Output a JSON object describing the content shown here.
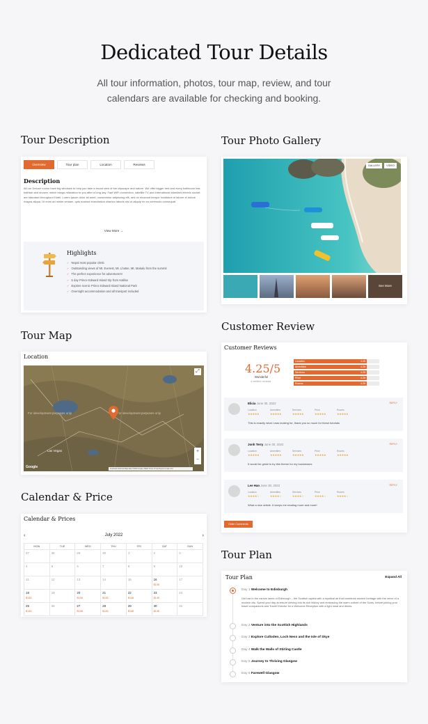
{
  "hero": {
    "title": "Dedicated Tour Details",
    "subtitle": "All tour information, photos, tour map, review, and tour calendars are available for checking and booking."
  },
  "sections": {
    "description": "Tour Description",
    "gallery": "Tour Photo Gallery",
    "map": "Tour Map",
    "review": "Customer Review",
    "calendar": "Calendar & Price",
    "plan": "Tour Plan"
  },
  "description_card": {
    "tabs": [
      "Overview",
      "Tour plan",
      "Location",
      "Reviews"
    ],
    "heading": "Description",
    "body": "All our Deluxe rooms have big windows to help you take a broad view of the cityscape and nature. We offer bigger bed and every bathroom has bathtub and shower, which brings relaxation to you after a long day. Fast WiFi connection, satellite TV and international standard electric socket are standard throughout Hotel. Lorem ipsum dolor sit amet, consectetur adipiscing elit, sed do eiusmod tempor incididunt ut labore et dolore magna aliqua. Ut enim ad minim veniam, quis nostrud exercitation ullamco laboris nisi ut aliquip ex ea commodo consequat.",
    "view_more": "View More →",
    "highlights_title": "Highlights",
    "highlights": [
      "Nepal most popular climb",
      "Outstanding views of Mt. Everest, Mt. Lhotse, Mt. Makalu from the summit",
      "The perfect experience for adventurers!",
      "5 day Prince Edward Island trip from Halifax",
      "Explore scenic Prince Edward Island National Park",
      "Overnight accommodation and all transport included"
    ]
  },
  "gallery_card": {
    "tags": [
      "GALLERY",
      "VIDEO"
    ],
    "see_more": "See More"
  },
  "map_card": {
    "label": "Location",
    "watermark": "For development purposes only",
    "city": "Las Vegas",
    "brand": "Google",
    "zoom_in": "+",
    "zoom_out": "−",
    "fullscreen": "⤢",
    "footer": "Keyboard shortcuts   Map data ©2022 Google, INEGI   Terms of Use   Report a map error"
  },
  "review_card": {
    "title": "Customer Reviews",
    "score": "4.25/5",
    "rating_word": "Wonderful",
    "count": "4 verified reviews",
    "bars": [
      {
        "label": "Location",
        "value": "4.25",
        "pct": 85
      },
      {
        "label": "Amenities",
        "value": "4.25",
        "pct": 85
      },
      {
        "label": "Services",
        "value": "4.25",
        "pct": 85
      },
      {
        "label": "Price",
        "value": "4.25",
        "pct": 85
      },
      {
        "label": "Rooms",
        "value": "4.25",
        "pct": 85
      }
    ],
    "categories": [
      "Location",
      "Amenities",
      "Services",
      "Price",
      "Rooms"
    ],
    "reviews": [
      {
        "name": "Elicia",
        "date": "June 30, 2022",
        "stars": "★★★★★",
        "text": "This is exactly what I was looking for, thank you so much for these tutorials"
      },
      {
        "name": "Jonh Terry",
        "date": "June 30, 2022",
        "stars": "★★★★★",
        "text": "It would be great to try this theme for my businesses"
      },
      {
        "name": "Lee Han",
        "date": "June 30, 2022",
        "stars": "★★★★☆",
        "text": "What a nice article. It keeps me reading more and more!"
      }
    ],
    "reply": "REPLY",
    "older": "Older Comments"
  },
  "calendar_card": {
    "title": "Calendar & Prices",
    "month": "July 2022",
    "prev": "‹",
    "next": "›",
    "weekdays": [
      "MON",
      "TUE",
      "WED",
      "THU",
      "FRI",
      "SAT",
      "SUN"
    ],
    "cells": [
      {
        "d": "27",
        "p": ""
      },
      {
        "d": "28",
        "p": ""
      },
      {
        "d": "29",
        "p": ""
      },
      {
        "d": "30",
        "p": ""
      },
      {
        "d": "1",
        "p": ""
      },
      {
        "d": "2",
        "p": ""
      },
      {
        "d": "3",
        "p": ""
      },
      {
        "d": "4",
        "p": ""
      },
      {
        "d": "5",
        "p": ""
      },
      {
        "d": "6",
        "p": ""
      },
      {
        "d": "7",
        "p": ""
      },
      {
        "d": "8",
        "p": ""
      },
      {
        "d": "9",
        "p": ""
      },
      {
        "d": "10",
        "p": ""
      },
      {
        "d": "11",
        "p": ""
      },
      {
        "d": "12",
        "p": ""
      },
      {
        "d": "13",
        "p": ""
      },
      {
        "d": "14",
        "p": ""
      },
      {
        "d": "15",
        "p": ""
      },
      {
        "d": "16",
        "p": "$146"
      },
      {
        "d": "17",
        "p": ""
      },
      {
        "d": "18",
        "p": "$146"
      },
      {
        "d": "19",
        "p": ""
      },
      {
        "d": "20",
        "p": "$146"
      },
      {
        "d": "21",
        "p": "$146"
      },
      {
        "d": "22",
        "p": "$146"
      },
      {
        "d": "23",
        "p": "$146"
      },
      {
        "d": "24",
        "p": ""
      },
      {
        "d": "25",
        "p": "$146"
      },
      {
        "d": "26",
        "p": ""
      },
      {
        "d": "27",
        "p": "$146"
      },
      {
        "d": "28",
        "p": "$146"
      },
      {
        "d": "29",
        "p": "$146"
      },
      {
        "d": "30",
        "p": "$146"
      },
      {
        "d": "31",
        "p": ""
      }
    ]
  },
  "plan_card": {
    "title": "Tour Plan",
    "expand": "Expand All",
    "days": [
      {
        "num": "Day 1",
        "title": "Welcome to Edinburgh"
      },
      {
        "num": "Day 2",
        "title": "Venture into the Scottish Highlands"
      },
      {
        "num": "Day 3",
        "title": "Explore Culloden, Loch Ness and the Isle of Skye"
      },
      {
        "num": "Day 4",
        "title": "Walk the Walls of Stirling Castle"
      },
      {
        "num": "Day 5",
        "title": "Journey to Thriving Glasgow"
      },
      {
        "num": "Day 6",
        "title": "Farewell Glasgow"
      }
    ],
    "day1_desc": "Get lost in the narrow lanes of Edinburgh – the Scottish capital with a mystical air that combines ancient heritage with the verve of a modern city. Spend your day at leisure delving into its rich history and embracing the warm culture of the Scots, before joining your travel companions and Travel Director for a Welcome Reception with a light meal and drinks."
  },
  "colors": {
    "accent": "#e06a2f",
    "background": "#f6f6f8",
    "sea": "#37b6be",
    "sand": "#e8dcc8"
  }
}
